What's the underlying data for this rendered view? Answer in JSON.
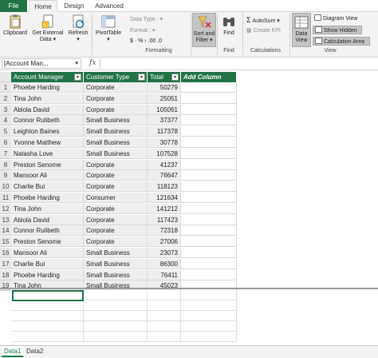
{
  "tabs": [
    {
      "label": "File"
    },
    {
      "label": "Home"
    },
    {
      "label": "Design"
    },
    {
      "label": "Advanced"
    }
  ],
  "ribbon": {
    "clipboard": "Clipboard",
    "get_external_line1": "Get External",
    "get_external_line2": "Data",
    "refresh": "Refresh",
    "pivottable": "PivotTable",
    "data_type": "Data Type :",
    "format": "Format :",
    "currency_row": "$ · % ›  .00  .0",
    "sort_line1": "Sort and",
    "sort_line2": "Filter",
    "find": "Find",
    "autosum": "AutoSum",
    "create_kpi": "Create KPI",
    "data_view_line1": "Data",
    "data_view_line2": "View",
    "diagram_view": "Diagram View",
    "show_hidden": "Show Hidden",
    "calculation_area": "Calculation Area",
    "groups": {
      "formatting": "Formatting",
      "find": "Find",
      "calculations": "Calculations",
      "view": "View"
    },
    "accent": "#217346"
  },
  "formula_bar": {
    "name_box": "[Account Man...",
    "fx": "fx",
    "value": ""
  },
  "columns": [
    {
      "label": "Account Manager"
    },
    {
      "label": "Customer Type"
    },
    {
      "label": "Total"
    },
    {
      "label": "Add Column"
    }
  ],
  "rows": [
    {
      "n": "1",
      "manager": "Phoebe Harding",
      "type": "Corporate",
      "total": "50279"
    },
    {
      "n": "2",
      "manager": "Tina John",
      "type": "Corporate",
      "total": "25051"
    },
    {
      "n": "3",
      "manager": "Abiola David",
      "type": "Corporate",
      "total": "105061"
    },
    {
      "n": "4",
      "manager": "Connor Rulibeth",
      "type": "Small Business",
      "total": "37377"
    },
    {
      "n": "5",
      "manager": "Leighton Baines",
      "type": "Small Business",
      "total": "117378"
    },
    {
      "n": "6",
      "manager": "Yvonne Matthew",
      "type": "Small Business",
      "total": "30778"
    },
    {
      "n": "7",
      "manager": "Natasha Love",
      "type": "Small Business",
      "total": "107528"
    },
    {
      "n": "8",
      "manager": "Preston Senome",
      "type": "Corporate",
      "total": "41237"
    },
    {
      "n": "9",
      "manager": "Mansoor Ali",
      "type": "Corporate",
      "total": "76647"
    },
    {
      "n": "10",
      "manager": "Charlie Bui",
      "type": "Corporate",
      "total": "118123"
    },
    {
      "n": "11",
      "manager": "Phoebe Harding",
      "type": "Consumer",
      "total": "121634"
    },
    {
      "n": "12",
      "manager": "Tina John",
      "type": "Corporate",
      "total": "141212"
    },
    {
      "n": "13",
      "manager": "Abiola David",
      "type": "Corporate",
      "total": "117423"
    },
    {
      "n": "14",
      "manager": "Connor Rulibeth",
      "type": "Corporate",
      "total": "72318"
    },
    {
      "n": "15",
      "manager": "Preston Senome",
      "type": "Corporate",
      "total": "27006"
    },
    {
      "n": "16",
      "manager": "Mansoor Ali",
      "type": "Small Business",
      "total": "23073"
    },
    {
      "n": "17",
      "manager": "Charlie Bui",
      "type": "Small Business",
      "total": "86300"
    },
    {
      "n": "18",
      "manager": "Phoebe Harding",
      "type": "Small Business",
      "total": "76411"
    },
    {
      "n": "19",
      "manager": "Tina John",
      "type": "Small Business",
      "total": "45023"
    }
  ],
  "sheets": [
    {
      "label": "Data1",
      "active": true
    },
    {
      "label": "Data2",
      "active": false
    }
  ]
}
